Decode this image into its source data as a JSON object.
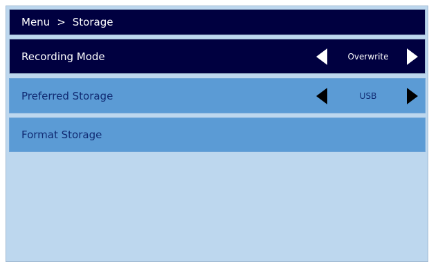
{
  "header": {
    "root": "Menu",
    "separator": ">",
    "current": "Storage"
  },
  "menu": {
    "items": [
      {
        "label": "Recording Mode",
        "value": "Overwrite",
        "selected": true
      },
      {
        "label": "Preferred Storage",
        "value": "USB",
        "selected": false
      },
      {
        "label": "Format Storage",
        "selected": false
      }
    ]
  },
  "colors": {
    "background": "#bdd7ee",
    "header_bg": "#000040",
    "selected_row_bg": "#000040",
    "row_bg": "#5b9bd5",
    "row_text": "#102a72",
    "selected_text": "#ffffff"
  },
  "icons": {
    "left": "triangle-left-icon",
    "right": "triangle-right-icon"
  }
}
